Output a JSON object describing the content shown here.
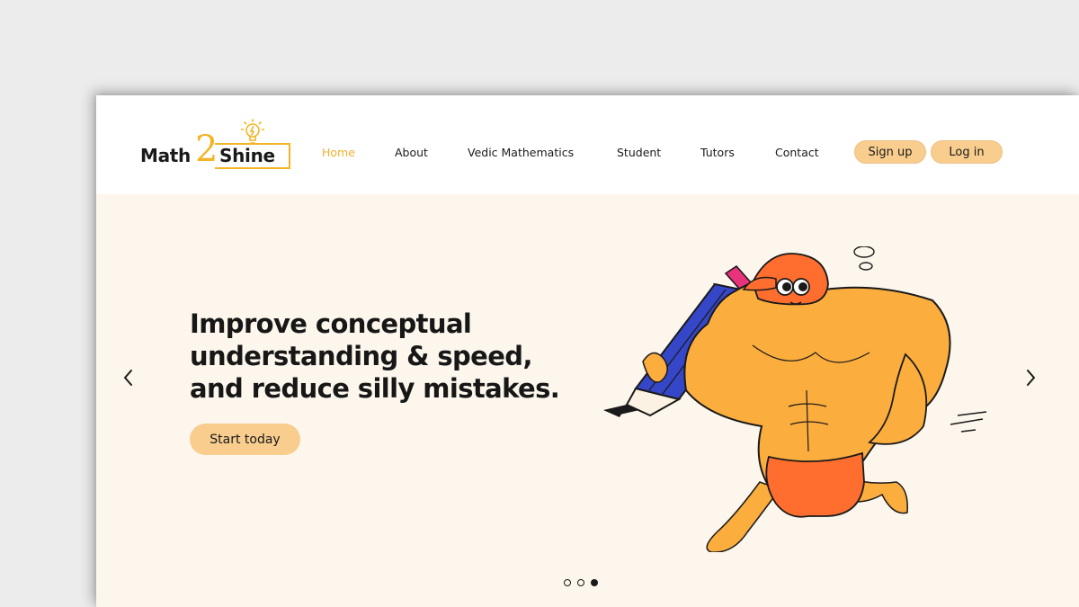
{
  "brand": {
    "name_left": "Math",
    "name_number": "2",
    "name_right": "Shine",
    "accent_color": "#f2b524"
  },
  "nav": {
    "items": [
      {
        "label": "Home",
        "active": true
      },
      {
        "label": "About",
        "active": false
      },
      {
        "label": "Vedic Mathematics",
        "active": false
      },
      {
        "label": "Student",
        "active": false
      },
      {
        "label": "Tutors",
        "active": false
      },
      {
        "label": "Contact",
        "active": false
      }
    ],
    "signup_label": "Sign up",
    "login_label": "Log in"
  },
  "hero": {
    "headline_lines": [
      "Improve conceptual",
      "understanding & speed,",
      "and reduce silly mistakes."
    ],
    "cta_label": "Start today",
    "background_color": "#fdf6ec",
    "button_color": "#f8cd8e",
    "prev_icon": "chevron-left-icon",
    "next_icon": "chevron-right-icon"
  },
  "carousel": {
    "slide_count": 3,
    "active_index": 2
  }
}
